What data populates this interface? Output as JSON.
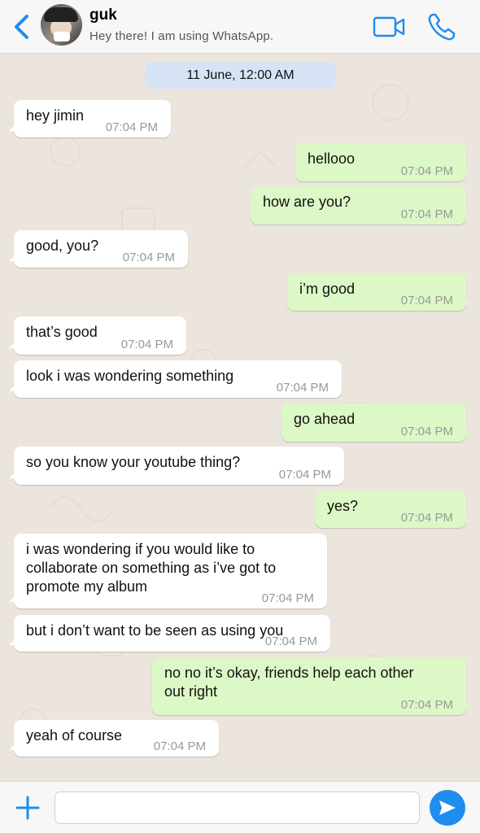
{
  "header": {
    "contact_name": "guk",
    "status": "Hey there! I am using WhatsApp."
  },
  "chat": {
    "date_label": "11 June, 12:00 AM",
    "messages": [
      {
        "dir": "in",
        "text": "hey jimin",
        "time": "07:04 PM"
      },
      {
        "dir": "out",
        "text": "hellooo",
        "time": "07:04 PM"
      },
      {
        "dir": "out",
        "text": "how are you?",
        "time": "07:04 PM"
      },
      {
        "dir": "in",
        "text": "good, you?",
        "time": "07:04 PM"
      },
      {
        "dir": "out",
        "text": "i’m good",
        "time": "07:04 PM"
      },
      {
        "dir": "in",
        "text": "that’s good",
        "time": "07:04 PM"
      },
      {
        "dir": "in",
        "text": "look i was wondering something",
        "time": "07:04 PM"
      },
      {
        "dir": "out",
        "text": "go ahead",
        "time": "07:04 PM"
      },
      {
        "dir": "in",
        "text": "so you know your youtube thing?",
        "time": "07:04 PM"
      },
      {
        "dir": "out",
        "text": "yes?",
        "time": "07:04 PM"
      },
      {
        "dir": "in",
        "text": "i was wondering if you would like to\ncollaborate on something as i’ve got to\npromote my album",
        "time": "07:04 PM"
      },
      {
        "dir": "in",
        "text": "but i don’t want to be seen as using you",
        "time": "07:04 PM"
      },
      {
        "dir": "out",
        "text": "no no it’s okay, friends help each other\nout right",
        "time": "07:04 PM"
      },
      {
        "dir": "in",
        "text": "yeah of course",
        "time": "07:04 PM"
      }
    ]
  },
  "composer": {
    "input_value": ""
  },
  "colors": {
    "accent": "#1f8cef",
    "incoming_bubble": "#ffffff",
    "outgoing_bubble": "#dcf8c6",
    "date_chip": "#d6e3f5",
    "chat_background": "#ece5dd"
  },
  "icons": {
    "back": "chevron-left-icon",
    "video": "video-camera-icon",
    "call": "phone-icon",
    "attach": "plus-icon",
    "send": "send-icon"
  }
}
